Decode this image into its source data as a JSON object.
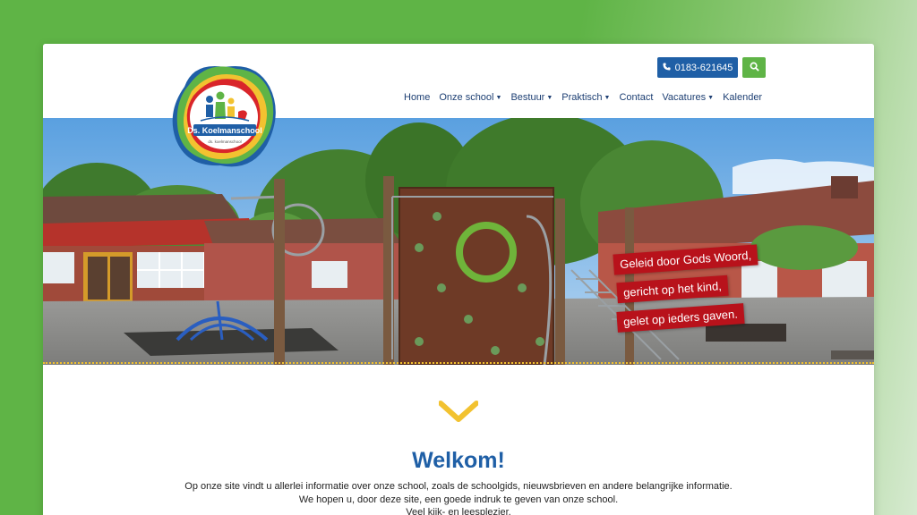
{
  "school": {
    "name": "Ds. Koelmanschool",
    "logo_subtext": "ds. koelmanschool"
  },
  "header": {
    "phone": "0183-621645",
    "phone_icon": "phone-icon",
    "search_icon": "search-icon"
  },
  "nav": {
    "items": [
      {
        "label": "Home",
        "dropdown": false
      },
      {
        "label": "Onze school",
        "dropdown": true
      },
      {
        "label": "Bestuur",
        "dropdown": true
      },
      {
        "label": "Praktisch",
        "dropdown": true
      },
      {
        "label": "Contact",
        "dropdown": false
      },
      {
        "label": "Vacatures",
        "dropdown": true
      },
      {
        "label": "Kalender",
        "dropdown": false
      }
    ]
  },
  "hero": {
    "slogans": [
      "Geleid door Gods Woord,",
      "gericht op het kind,",
      "gelet op ieders gaven."
    ]
  },
  "welcome": {
    "title": "Welkom!",
    "lines": [
      "Op onze site vindt u allerlei informatie over onze school, zoals de schoolgids, nieuwsbrieven en andere belangrijke informatie.",
      "We hopen u, door deze site, een goede indruk te geven van onze school.",
      "Veel kijk- en leesplezier."
    ]
  },
  "colors": {
    "brand_blue": "#1f5fa6",
    "brand_green": "#5fb446",
    "slogan_red": "#b8121b",
    "accent_yellow": "#f2c230"
  }
}
